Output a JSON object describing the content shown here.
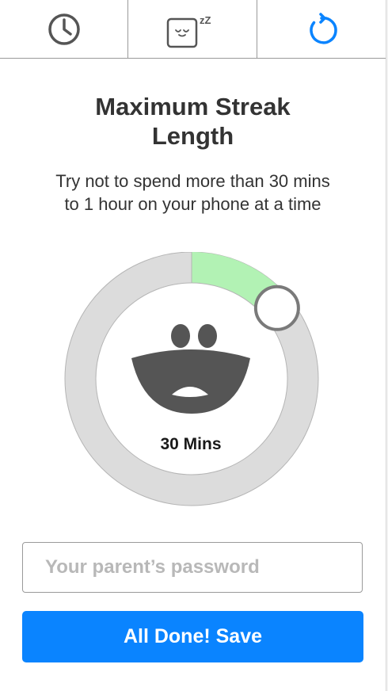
{
  "tabs": [
    {
      "icon": "clock-icon"
    },
    {
      "icon": "sleeping-face-icon",
      "text": "zZ"
    },
    {
      "icon": "reset-icon"
    }
  ],
  "heading": {
    "line1": "Maximum Streak",
    "line2": "Length"
  },
  "description": {
    "line1": "Try not to spend more than 30 mins",
    "line2": "to 1 hour on your phone at a time"
  },
  "dial": {
    "value_label": "30 Mins",
    "fraction": 0.14,
    "face": "happy-face-icon",
    "colors": {
      "track": "#dcdcdc",
      "progress": "#b2f2b4",
      "mouth": "#555555",
      "accent": "#0a84ff"
    }
  },
  "password": {
    "placeholder": "Your parent’s password",
    "value": ""
  },
  "save_button": {
    "label": "All Done! Save"
  }
}
